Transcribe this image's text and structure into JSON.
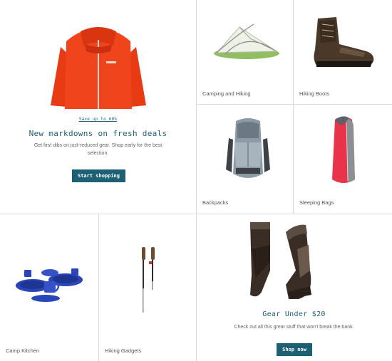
{
  "promo_markdowns": {
    "save_link": "Save up to 60%",
    "headline": "New markdowns on fresh deals",
    "subtext": "Get first dibs on just-reduced gear. Shop early for the best selection.",
    "button": "Start shopping",
    "image": "red-rain-jacket"
  },
  "categories": [
    {
      "label": "Camping and Hiking",
      "image": "tent"
    },
    {
      "label": "Hiking Boots",
      "image": "hiking-boot"
    },
    {
      "label": "Backpacks",
      "image": "backpack"
    },
    {
      "label": "Sleeping Bags",
      "image": "sleeping-bag"
    },
    {
      "label": "Camp Kitchen",
      "image": "enamel-dishware"
    },
    {
      "label": "Hiking Gadgets",
      "image": "trekking-poles"
    }
  ],
  "promo_under20": {
    "headline": "Gear Under $20",
    "subtext": "Check out all this great stuff that won't break the bank.",
    "button": "Shop now",
    "image": "hiking-socks"
  },
  "colors": {
    "accent": "#1d5f73",
    "divider": "#dcdcdc",
    "jacket": "#f0451c",
    "sleeping_bag": "#e8334a",
    "enamel_blue": "#2a45b8"
  }
}
